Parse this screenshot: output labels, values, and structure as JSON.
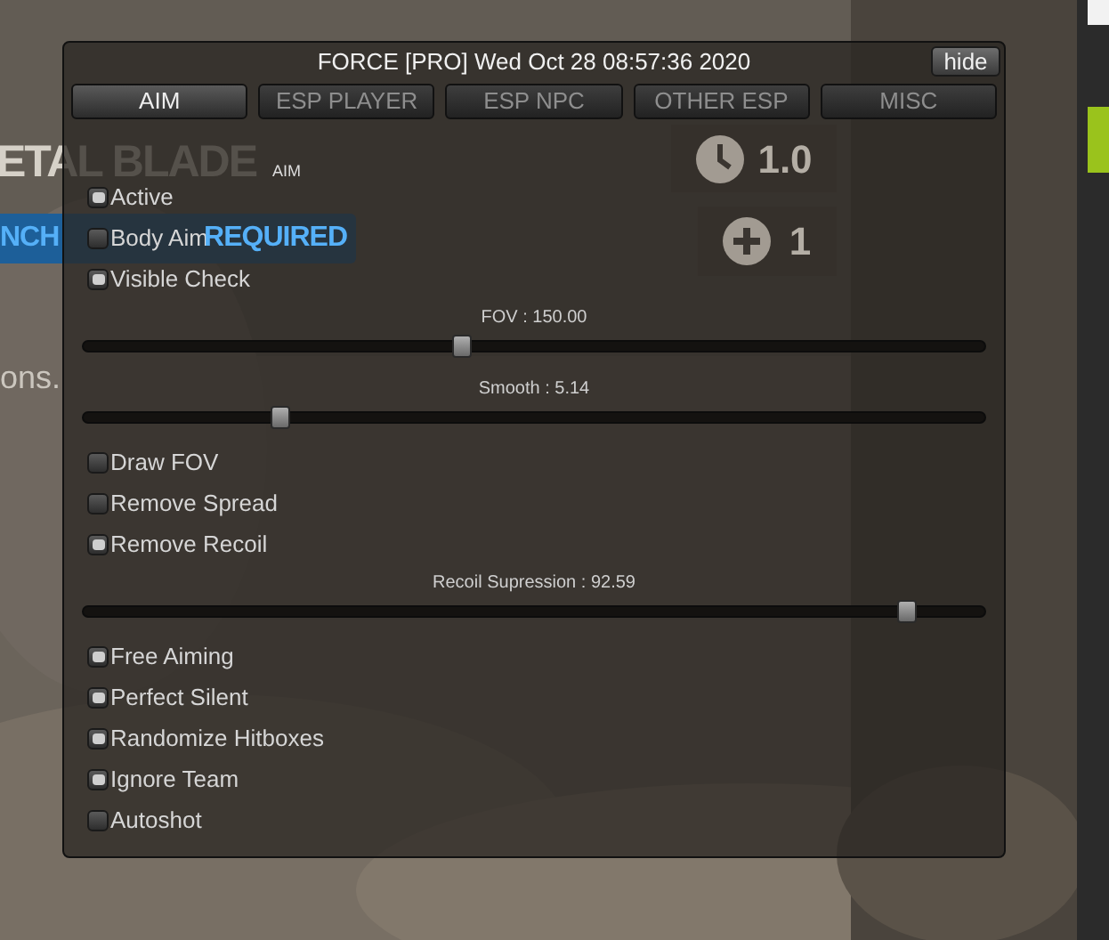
{
  "game_hud": {
    "heading": "ETAL BLADE",
    "banner_parts": [
      "NCH",
      "REQUIRED"
    ],
    "hint": "ons.",
    "timer": "1.0",
    "count": "1"
  },
  "menu": {
    "title": "FORCE [PRO] Wed Oct 28 08:57:36 2020",
    "hide_button": "hide",
    "tabs": [
      {
        "label": "AIM",
        "selected": true
      },
      {
        "label": "ESP PLAYER",
        "selected": false
      },
      {
        "label": "ESP NPC",
        "selected": false
      },
      {
        "label": "OTHER ESP",
        "selected": false
      },
      {
        "label": "MISC",
        "selected": false
      }
    ],
    "section_label": "AIM",
    "controls": [
      {
        "kind": "checkbox",
        "label": "Active",
        "checked": true
      },
      {
        "kind": "checkbox",
        "label": "Body Aim",
        "checked": false
      },
      {
        "kind": "checkbox",
        "label": "Visible Check",
        "checked": true
      },
      {
        "kind": "slider",
        "label": "FOV : 150.00",
        "level": 0.42
      },
      {
        "kind": "slider",
        "label": "Smooth : 5.14",
        "level": 0.22
      },
      {
        "kind": "checkbox",
        "label": "Draw FOV",
        "checked": false
      },
      {
        "kind": "checkbox",
        "label": "Remove Spread",
        "checked": false
      },
      {
        "kind": "checkbox",
        "label": "Remove Recoil",
        "checked": true
      },
      {
        "kind": "slider",
        "label": "Recoil Supression : 92.59",
        "level": 0.915
      },
      {
        "kind": "checkbox",
        "label": "Free Aiming",
        "checked": true
      },
      {
        "kind": "checkbox",
        "label": "Perfect Silent",
        "checked": true
      },
      {
        "kind": "checkbox",
        "label": "Randomize Hitboxes",
        "checked": true
      },
      {
        "kind": "checkbox",
        "label": "Ignore Team",
        "checked": true
      },
      {
        "kind": "checkbox",
        "label": "Autoshot",
        "checked": false
      }
    ]
  }
}
